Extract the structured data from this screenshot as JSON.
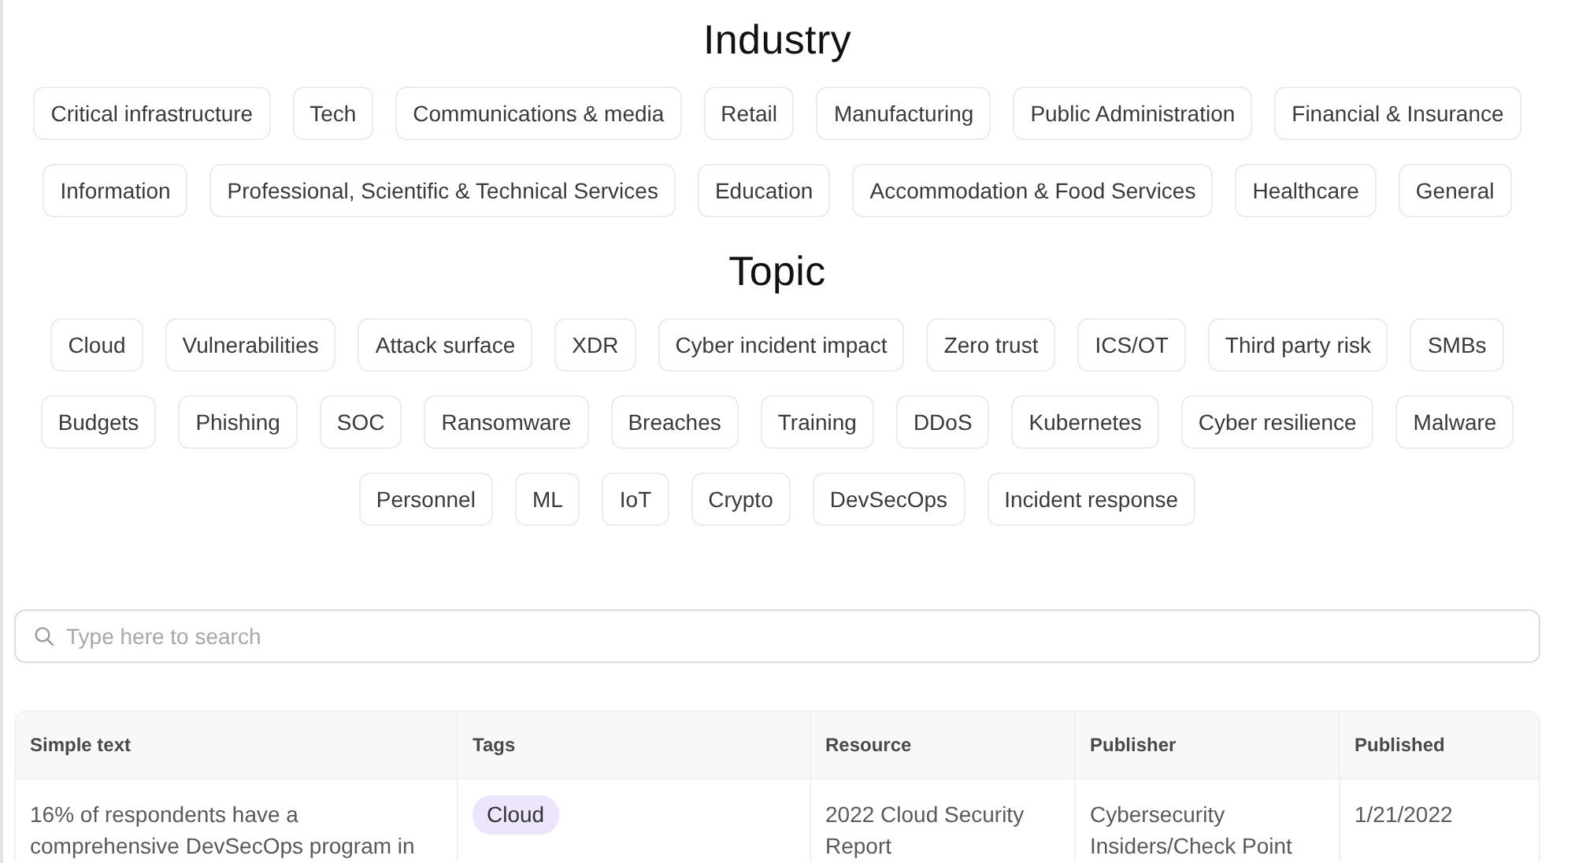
{
  "sections": [
    {
      "title": "Industry",
      "chips": [
        {
          "label": "Critical infrastructure",
          "selected": false
        },
        {
          "label": "Tech",
          "selected": false
        },
        {
          "label": "Communications & media",
          "selected": false
        },
        {
          "label": "Retail",
          "selected": false
        },
        {
          "label": "Manufacturing",
          "selected": false
        },
        {
          "label": "Public Administration",
          "selected": false
        },
        {
          "label": "Financial & Insurance",
          "selected": false
        },
        {
          "label": "Information",
          "selected": false
        },
        {
          "label": "Professional, Scientific & Technical Services",
          "selected": false
        },
        {
          "label": "Education",
          "selected": false
        },
        {
          "label": "Accommodation & Food Services",
          "selected": false
        },
        {
          "label": "Healthcare",
          "selected": false
        },
        {
          "label": "General",
          "selected": false
        }
      ]
    },
    {
      "title": "Topic",
      "chips": [
        {
          "label": "Cloud",
          "selected": false
        },
        {
          "label": "Vulnerabilities",
          "selected": false
        },
        {
          "label": "Attack surface",
          "selected": false
        },
        {
          "label": "XDR",
          "selected": false
        },
        {
          "label": "Cyber incident impact",
          "selected": false
        },
        {
          "label": "Zero trust",
          "selected": false
        },
        {
          "label": "ICS/OT",
          "selected": false
        },
        {
          "label": "Third party risk",
          "selected": false
        },
        {
          "label": "SMBs",
          "selected": false
        },
        {
          "label": "Budgets",
          "selected": false
        },
        {
          "label": "Phishing",
          "selected": false
        },
        {
          "label": "SOC",
          "selected": false
        },
        {
          "label": "Ransomware",
          "selected": false
        },
        {
          "label": "Breaches",
          "selected": false
        },
        {
          "label": "Training",
          "selected": false
        },
        {
          "label": "DDoS",
          "selected": false
        },
        {
          "label": "Kubernetes",
          "selected": false
        },
        {
          "label": "Cyber resilience",
          "selected": false
        },
        {
          "label": "Malware",
          "selected": false
        },
        {
          "label": "Personnel",
          "selected": false
        },
        {
          "label": "ML",
          "selected": false
        },
        {
          "label": "IoT",
          "selected": false
        },
        {
          "label": "Crypto",
          "selected": false
        },
        {
          "label": "DevSecOps",
          "selected": false
        },
        {
          "label": "Incident response",
          "selected": false
        }
      ]
    }
  ],
  "search": {
    "placeholder": "Type here to search"
  },
  "table": {
    "columns": [
      "Simple text",
      "Tags",
      "Resource",
      "Publisher",
      "Published"
    ],
    "rows": [
      {
        "cells": [
          {
            "kind": "text",
            "text": "16% of respondents have a comprehensive DevSecOps program in"
          },
          {
            "kind": "tags",
            "tags": [
              {
                "label": "Cloud"
              }
            ]
          },
          {
            "kind": "text",
            "text": "2022 Cloud Security Report"
          },
          {
            "kind": "text",
            "text": "Cybersecurity Insiders/Check Point"
          },
          {
            "kind": "text",
            "text": "1/21/2022"
          }
        ]
      }
    ]
  }
}
